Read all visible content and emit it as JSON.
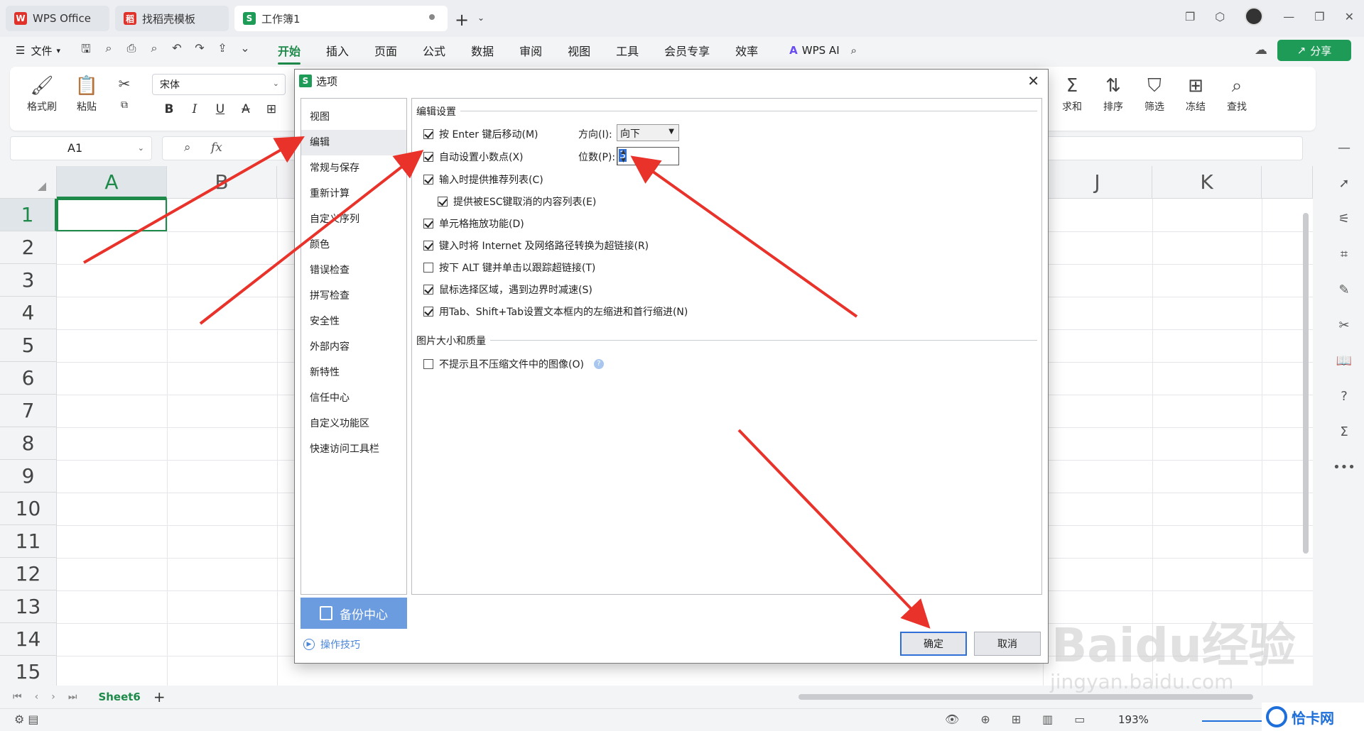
{
  "tabs": {
    "wps": "WPS Office",
    "template": "找稻壳模板",
    "workbook": "工作簿1"
  },
  "menubar": {
    "file": "文件",
    "items": [
      "开始",
      "插入",
      "页面",
      "公式",
      "数据",
      "审阅",
      "视图",
      "工具",
      "会员专享",
      "效率"
    ],
    "active": "开始",
    "wps_ai": "WPS AI",
    "share": "分享"
  },
  "ribbon": {
    "format_painter": "格式刷",
    "paste": "粘贴",
    "font": "宋体",
    "sum": "求和",
    "sort": "排序",
    "filter": "筛选",
    "freeze": "冻结",
    "find": "查找"
  },
  "formula_bar": {
    "name_box": "A1",
    "fx": "fx"
  },
  "grid": {
    "columns": [
      "A",
      "B",
      "J",
      "K"
    ],
    "rows": [
      "1",
      "2",
      "3",
      "4",
      "5",
      "6",
      "7",
      "8",
      "9",
      "10",
      "11",
      "12",
      "13",
      "14",
      "15"
    ],
    "selected_cell": "A1"
  },
  "sheets": {
    "active": "Sheet6"
  },
  "status": {
    "zoom": "193%"
  },
  "dialog": {
    "title": "选项",
    "nav": [
      "视图",
      "编辑",
      "常规与保存",
      "重新计算",
      "自定义序列",
      "颜色",
      "错误检查",
      "拼写检查",
      "安全性",
      "外部内容",
      "新特性",
      "信任中心",
      "自定义功能区",
      "快速访问工具栏"
    ],
    "nav_active": "编辑",
    "backup": "备份中心",
    "tips": "操作技巧",
    "edit_section": "编辑设置",
    "options": [
      {
        "label": "按 Enter 键后移动(M)",
        "checked": true
      },
      {
        "label": "自动设置小数点(X)",
        "checked": true
      },
      {
        "label": "输入时提供推荐列表(C)",
        "checked": true
      },
      {
        "label": "提供被ESC键取消的内容列表(E)",
        "checked": true
      },
      {
        "label": "单元格拖放功能(D)",
        "checked": true
      },
      {
        "label": "键入时将 Internet 及网络路径转换为超链接(R)",
        "checked": true
      },
      {
        "label": "按下 ALT 键并单击以跟踪超链接(T)",
        "checked": false
      },
      {
        "label": "鼠标选择区域，遇到边界时减速(S)",
        "checked": true
      },
      {
        "label": "用Tab、Shift+Tab设置文本框内的左缩进和首行缩进(N)",
        "checked": true
      }
    ],
    "direction_label": "方向(I):",
    "direction_value": "向下",
    "places_label": "位数(P):",
    "places_value": "3",
    "image_section": "图片大小和质量",
    "image_option": {
      "label": "不提示且不压缩文件中的图像(O)",
      "checked": false
    },
    "ok": "确定",
    "cancel": "取消"
  },
  "watermark": {
    "baidu": "Baidu经验",
    "url": "jingyan.baidu.com",
    "corner": "恰卡网"
  },
  "colors": {
    "accent_green": "#1e8a4a",
    "share_green": "#1e9b56",
    "annotation_red": "#e8322a",
    "backup_blue": "#6c9ce0"
  }
}
